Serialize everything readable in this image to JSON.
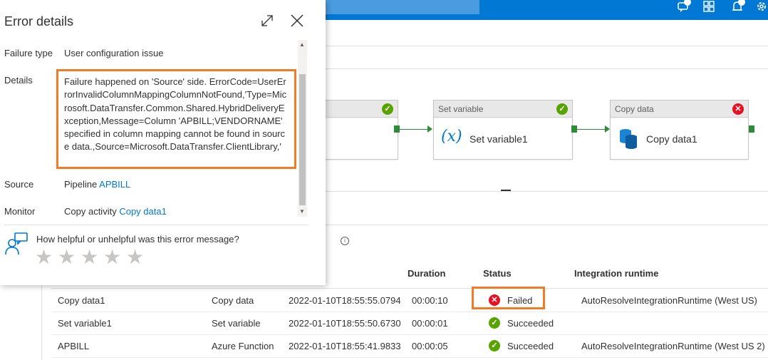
{
  "topbar": {
    "icons": [
      "feedback-icon",
      "directory-icon",
      "notifications-icon",
      "settings-icon"
    ],
    "badges": [
      "",
      "",
      ""
    ]
  },
  "pipeline": {
    "activities": [
      {
        "type_label": "",
        "name": "",
        "status": "succeeded"
      },
      {
        "type_label": "Set variable",
        "name": "Set variable1",
        "icon": "x",
        "status": "succeeded"
      },
      {
        "type_label": "Copy data",
        "name": "Copy data1",
        "status": "failed"
      }
    ]
  },
  "runs": {
    "headers": {
      "duration": "Duration",
      "status": "Status",
      "runtime": "Integration runtime"
    },
    "rows": [
      {
        "name": "Copy data1",
        "type": "Copy data",
        "start": "2022-01-10T18:55:55.07942",
        "duration": "00:00:10",
        "status": "Failed",
        "runtime": "AutoResolveIntegrationRuntime (West US)"
      },
      {
        "name": "Set variable1",
        "type": "Set variable",
        "start": "2022-01-10T18:55:50.67303",
        "duration": "00:00:01",
        "status": "Succeeded",
        "runtime": ""
      },
      {
        "name": "APBILL",
        "type": "Azure Function",
        "start": "2022-01-10T18:55:41.98338",
        "duration": "00:00:05",
        "status": "Succeeded",
        "runtime": "AutoResolveIntegrationRuntime (West US 2)"
      }
    ]
  },
  "error_panel": {
    "title": "Error details",
    "failure_type_label": "Failure type",
    "failure_type": "User configuration issue",
    "details_label": "Details",
    "details": "Failure happened on 'Source' side. ErrorCode=UserErrorInvalidColumnMappingColumnNotFound,'Type=Microsoft.DataTransfer.Common.Shared.HybridDeliveryException,Message=Column 'APBILL;VENDORNAME' specified in column mapping cannot be found in source data.,Source=Microsoft.DataTransfer.ClientLibrary,'",
    "source_label": "Source",
    "source_prefix": "Pipeline",
    "source_link": "APBILL",
    "monitor_label": "Monitor",
    "monitor_prefix": "Copy activity",
    "monitor_link": "Copy data1",
    "feedback_question": "How helpful or unhelpful was this error message?",
    "rating": 0,
    "rating_max": 5
  },
  "colors": {
    "accent": "#0078d4",
    "success": "#57a300",
    "error": "#e81123",
    "highlight": "#f07c27"
  }
}
